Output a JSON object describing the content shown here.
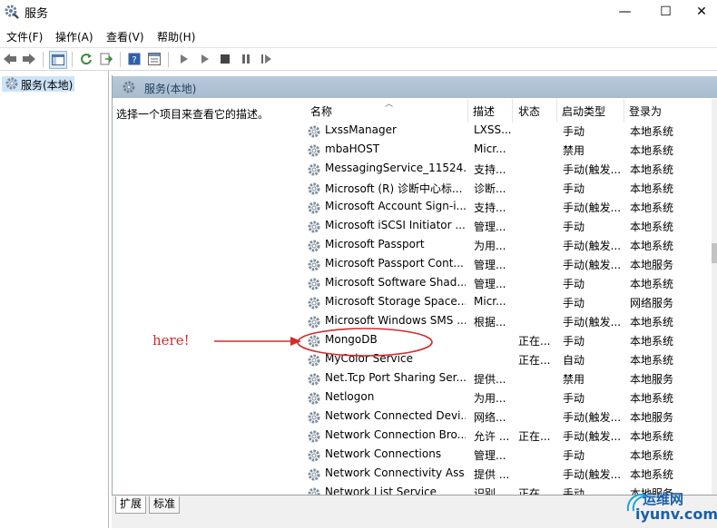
{
  "window": {
    "title": "服务",
    "buttons": [
      "—",
      "☐",
      "✕"
    ]
  },
  "menu": [
    "文件(F)",
    "操作(A)",
    "查看(V)",
    "帮助(H)"
  ],
  "tree": {
    "label": "服务(本地)"
  },
  "pane": {
    "header": "服务(本地)",
    "description": "选择一个项目来查看它的描述。"
  },
  "columns": [
    "名称",
    "描述",
    "状态",
    "启动类型",
    "登录为"
  ],
  "rows": [
    [
      "LxssManager",
      "LXSS...",
      "",
      "手动",
      "本地系统"
    ],
    [
      "mbaHOST",
      "Micr...",
      "",
      "禁用",
      "本地系统"
    ],
    [
      "MessagingService_11524...",
      "支持...",
      "",
      "手动(触发...",
      "本地系统"
    ],
    [
      "Microsoft (R) 诊断中心标...",
      "诊断...",
      "",
      "手动",
      "本地系统"
    ],
    [
      "Microsoft Account Sign-i...",
      "支持...",
      "",
      "手动(触发...",
      "本地系统"
    ],
    [
      "Microsoft iSCSI Initiator ...",
      "管理...",
      "",
      "手动",
      "本地系统"
    ],
    [
      "Microsoft Passport",
      "为用...",
      "",
      "手动(触发...",
      "本地系统"
    ],
    [
      "Microsoft Passport Cont...",
      "管理...",
      "",
      "手动(触发...",
      "本地服务"
    ],
    [
      "Microsoft Software Shad...",
      "管理...",
      "",
      "手动",
      "本地系统"
    ],
    [
      "Microsoft Storage Space...",
      "Micr...",
      "",
      "手动",
      "网络服务"
    ],
    [
      "Microsoft Windows SMS ...",
      "根据...",
      "",
      "手动(触发...",
      "本地系统"
    ],
    [
      "MongoDB",
      "",
      "正在...",
      "手动",
      "本地系统"
    ],
    [
      "MyColor Service",
      "",
      "正在...",
      "自动",
      "本地系统"
    ],
    [
      "Net.Tcp Port Sharing Ser...",
      "提供...",
      "",
      "禁用",
      "本地服务"
    ],
    [
      "Netlogon",
      "为用...",
      "",
      "手动",
      "本地系统"
    ],
    [
      "Network Connected Devi...",
      "网络...",
      "",
      "手动(触发...",
      "本地服务"
    ],
    [
      "Network Connection Bro...",
      "允许 ...",
      "正在...",
      "手动(触发...",
      "本地系统"
    ],
    [
      "Network Connections",
      "管理...",
      "",
      "手动",
      "本地系统"
    ],
    [
      "Network Connectivity Ass...",
      "提供 ...",
      "",
      "手动(触发...",
      "本地系统"
    ],
    [
      "Network List Service",
      "识别...",
      "正在...",
      "手动",
      "本地服务"
    ]
  ],
  "tabs": [
    "扩展",
    "标准"
  ],
  "annotation": {
    "text": "here!",
    "color": "#d42b2b"
  },
  "watermark": {
    "text1": "运维网",
    "text2": "iyunv.com"
  }
}
